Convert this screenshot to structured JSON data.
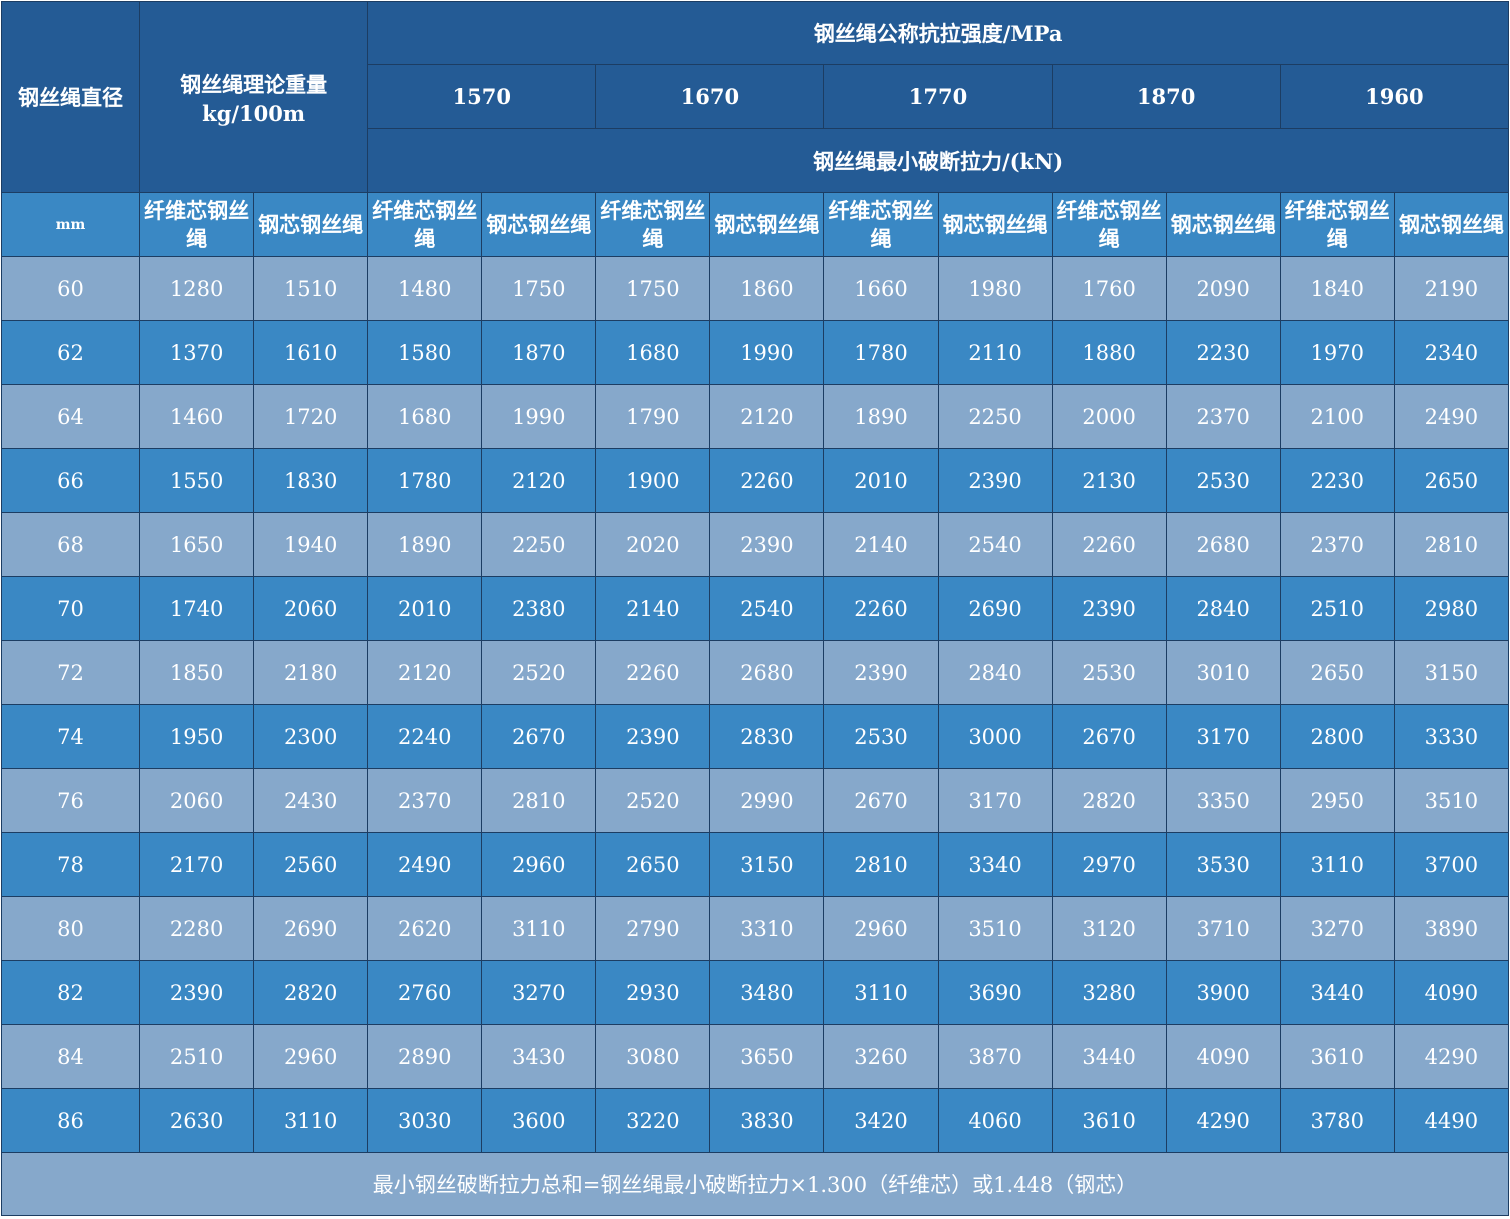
{
  "header": {
    "diameter_label": "钢丝绳直径",
    "weight_label_line1": "钢丝绳理论重量",
    "weight_label_line2": "kg/100m",
    "strength_label": "钢丝绳公称抗拉强度/MPa",
    "strengths": [
      "1570",
      "1670",
      "1770",
      "1870",
      "1960"
    ],
    "breaking_force_label": "钢丝绳最小破断拉力/(kN)",
    "unit": "mm",
    "fiber_core": "纤维芯钢丝绳",
    "steel_core": "钢芯钢丝绳"
  },
  "rows": [
    [
      "60",
      "1280",
      "1510",
      "1480",
      "1750",
      "1750",
      "1860",
      "1660",
      "1980",
      "1760",
      "2090",
      "1840",
      "2190"
    ],
    [
      "62",
      "1370",
      "1610",
      "1580",
      "1870",
      "1680",
      "1990",
      "1780",
      "2110",
      "1880",
      "2230",
      "1970",
      "2340"
    ],
    [
      "64",
      "1460",
      "1720",
      "1680",
      "1990",
      "1790",
      "2120",
      "1890",
      "2250",
      "2000",
      "2370",
      "2100",
      "2490"
    ],
    [
      "66",
      "1550",
      "1830",
      "1780",
      "2120",
      "1900",
      "2260",
      "2010",
      "2390",
      "2130",
      "2530",
      "2230",
      "2650"
    ],
    [
      "68",
      "1650",
      "1940",
      "1890",
      "2250",
      "2020",
      "2390",
      "2140",
      "2540",
      "2260",
      "2680",
      "2370",
      "2810"
    ],
    [
      "70",
      "1740",
      "2060",
      "2010",
      "2380",
      "2140",
      "2540",
      "2260",
      "2690",
      "2390",
      "2840",
      "2510",
      "2980"
    ],
    [
      "72",
      "1850",
      "2180",
      "2120",
      "2520",
      "2260",
      "2680",
      "2390",
      "2840",
      "2530",
      "3010",
      "2650",
      "3150"
    ],
    [
      "74",
      "1950",
      "2300",
      "2240",
      "2670",
      "2390",
      "2830",
      "2530",
      "3000",
      "2670",
      "3170",
      "2800",
      "3330"
    ],
    [
      "76",
      "2060",
      "2430",
      "2370",
      "2810",
      "2520",
      "2990",
      "2670",
      "3170",
      "2820",
      "3350",
      "2950",
      "3510"
    ],
    [
      "78",
      "2170",
      "2560",
      "2490",
      "2960",
      "2650",
      "3150",
      "2810",
      "3340",
      "2970",
      "3530",
      "3110",
      "3700"
    ],
    [
      "80",
      "2280",
      "2690",
      "2620",
      "3110",
      "2790",
      "3310",
      "2960",
      "3510",
      "3120",
      "3710",
      "3270",
      "3890"
    ],
    [
      "82",
      "2390",
      "2820",
      "2760",
      "3270",
      "2930",
      "3480",
      "3110",
      "3690",
      "3280",
      "3900",
      "3440",
      "4090"
    ],
    [
      "84",
      "2510",
      "2960",
      "2890",
      "3430",
      "3080",
      "3650",
      "3260",
      "3870",
      "3440",
      "4090",
      "3610",
      "4290"
    ],
    [
      "86",
      "2630",
      "3110",
      "3030",
      "3600",
      "3220",
      "3830",
      "3420",
      "4060",
      "3610",
      "4290",
      "3780",
      "4490"
    ]
  ],
  "footer": "最小钢丝破断拉力总和=钢丝绳最小破断拉力×1.300（纤维芯）或1.448（钢芯）"
}
